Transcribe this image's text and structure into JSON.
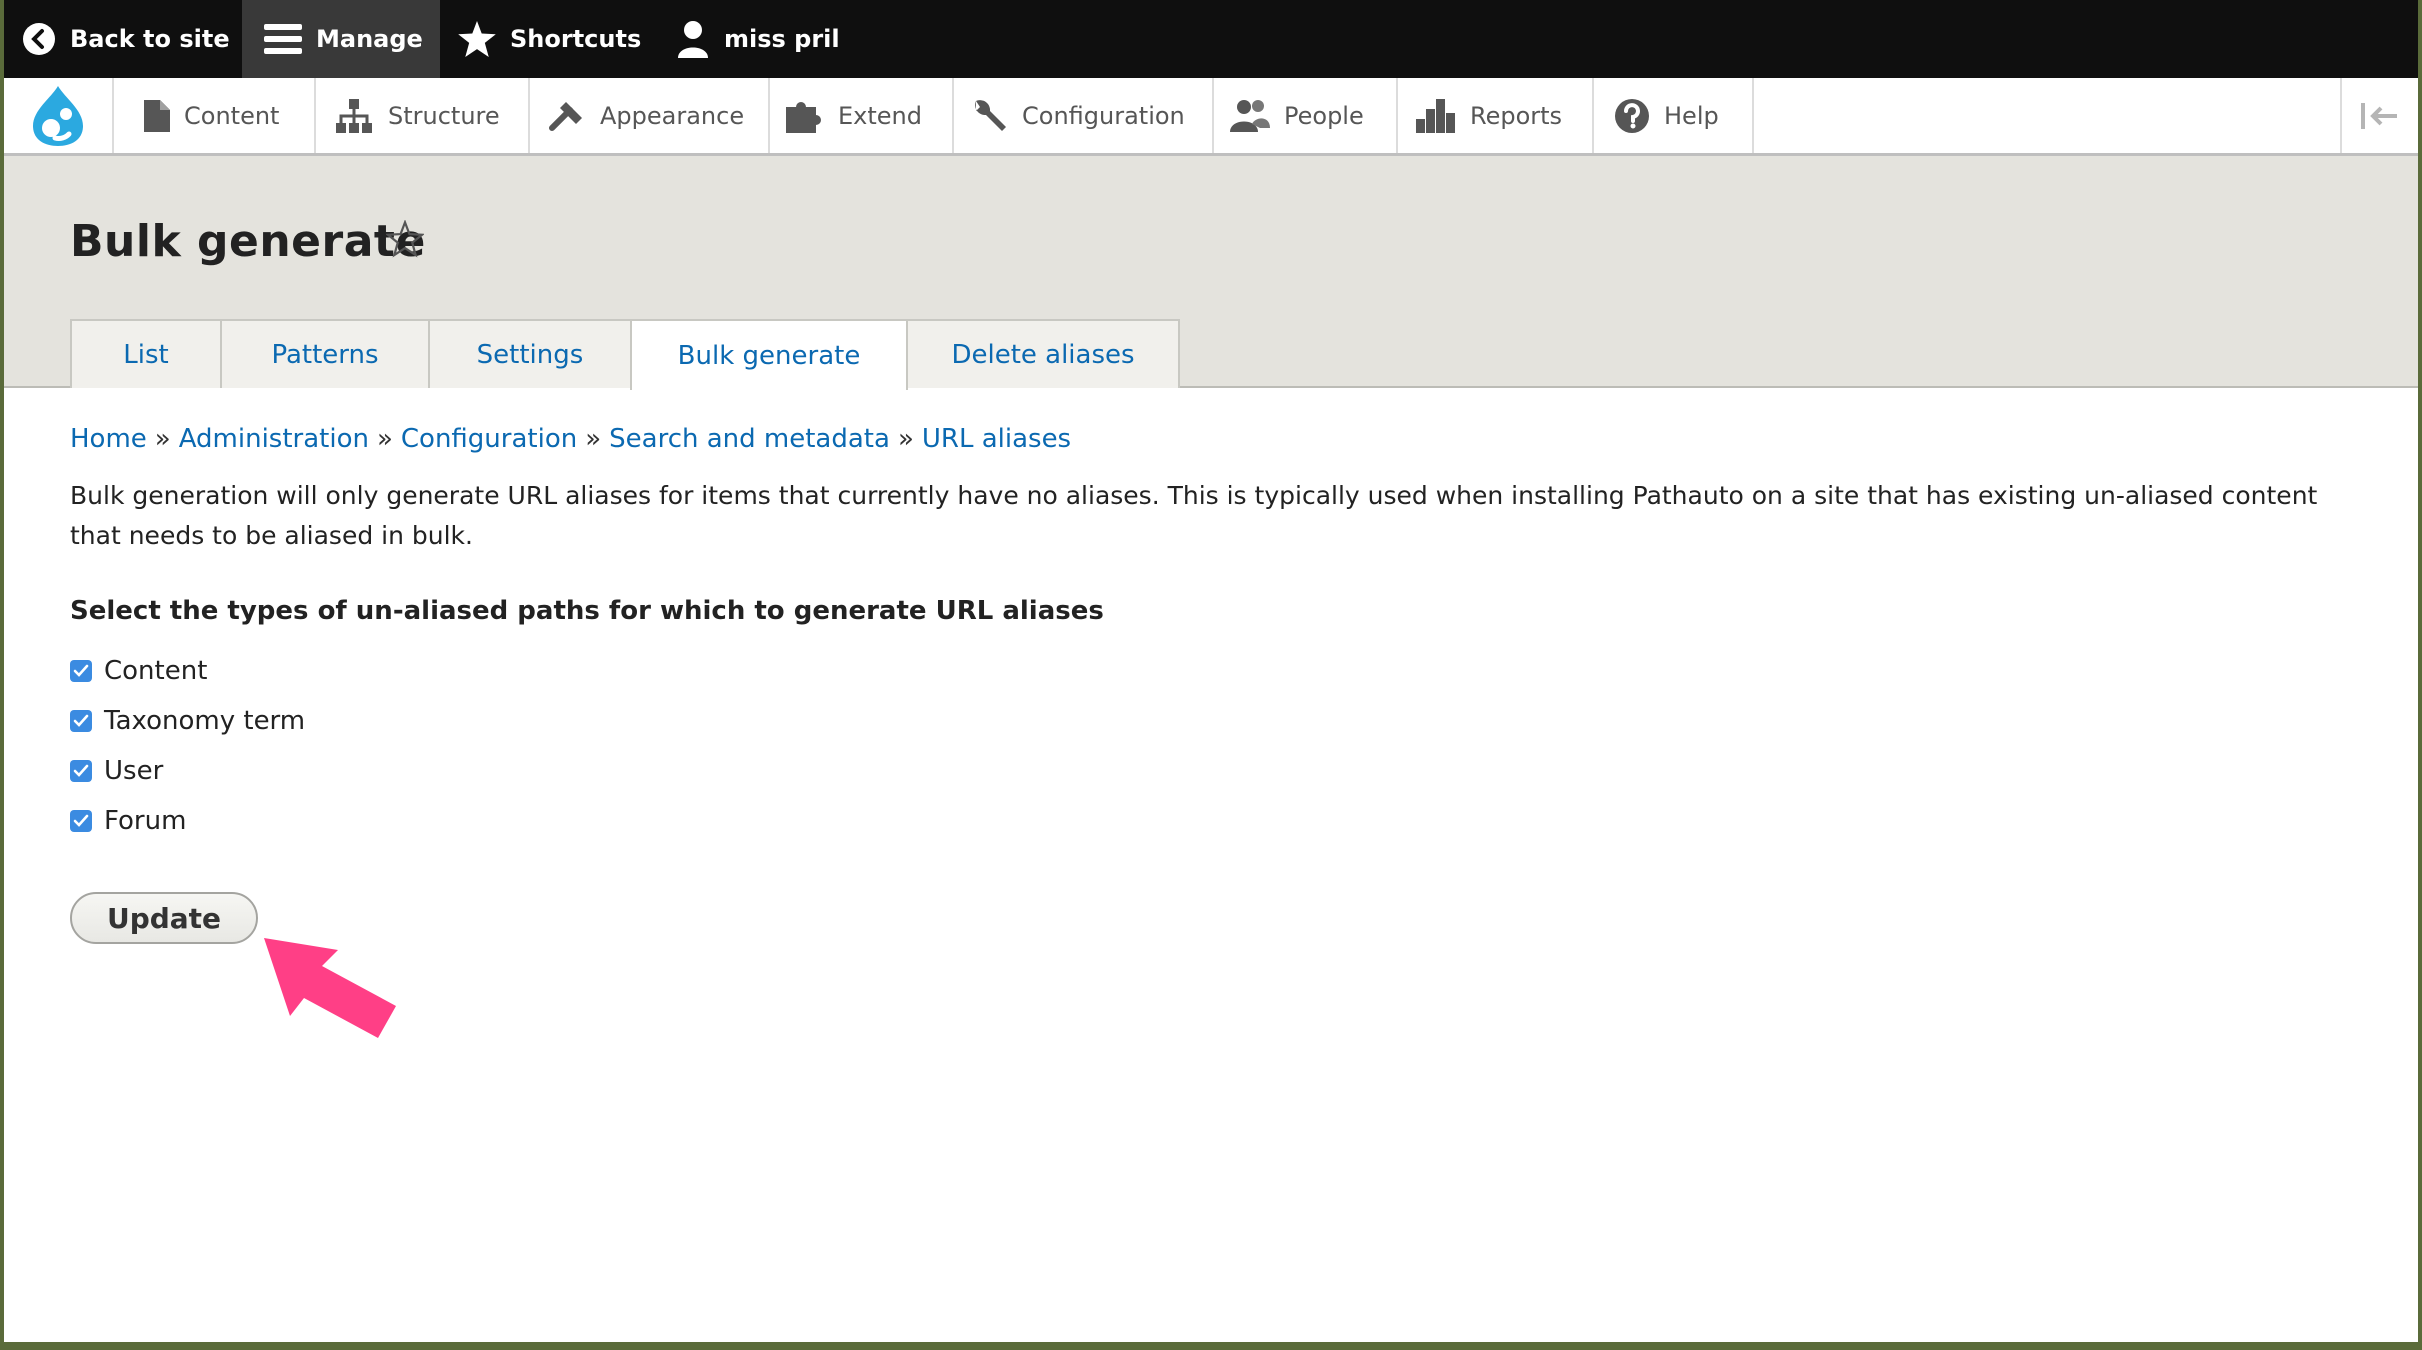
{
  "toolbar": {
    "back_label": "Back to site",
    "manage_label": "Manage",
    "shortcuts_label": "Shortcuts",
    "user_label": "miss pril"
  },
  "tray": {
    "items": [
      {
        "label": "Content",
        "icon": "document-icon"
      },
      {
        "label": "Structure",
        "icon": "sitemap-icon"
      },
      {
        "label": "Appearance",
        "icon": "paintbrush-icon"
      },
      {
        "label": "Extend",
        "icon": "puzzle-icon"
      },
      {
        "label": "Configuration",
        "icon": "wrench-icon"
      },
      {
        "label": "People",
        "icon": "people-icon"
      },
      {
        "label": "Reports",
        "icon": "bar-chart-icon"
      },
      {
        "label": "Help",
        "icon": "help-icon"
      }
    ]
  },
  "page": {
    "title": "Bulk generate"
  },
  "tabs": [
    {
      "label": "List",
      "active": false
    },
    {
      "label": "Patterns",
      "active": false
    },
    {
      "label": "Settings",
      "active": false
    },
    {
      "label": "Bulk generate",
      "active": true
    },
    {
      "label": "Delete aliases",
      "active": false
    }
  ],
  "breadcrumb": [
    "Home",
    "Administration",
    "Configuration",
    "Search and metadata",
    "URL aliases"
  ],
  "breadcrumb_sep": "»",
  "description": "Bulk generation will only generate URL aliases for items that currently have no aliases. This is typically used when installing Pathauto on a site that has existing un-aliased content that needs to be aliased in bulk.",
  "form": {
    "label": "Select the types of un-aliased paths for which to generate URL aliases",
    "options": [
      {
        "label": "Content",
        "checked": true
      },
      {
        "label": "Taxonomy term",
        "checked": true
      },
      {
        "label": "User",
        "checked": true
      },
      {
        "label": "Forum",
        "checked": true
      }
    ],
    "submit_label": "Update"
  },
  "colors": {
    "link": "#0b69b1",
    "toolbar_bg": "#0f0f0f",
    "checkbox": "#3b8be1",
    "annotation_arrow": "#ff3f86"
  }
}
